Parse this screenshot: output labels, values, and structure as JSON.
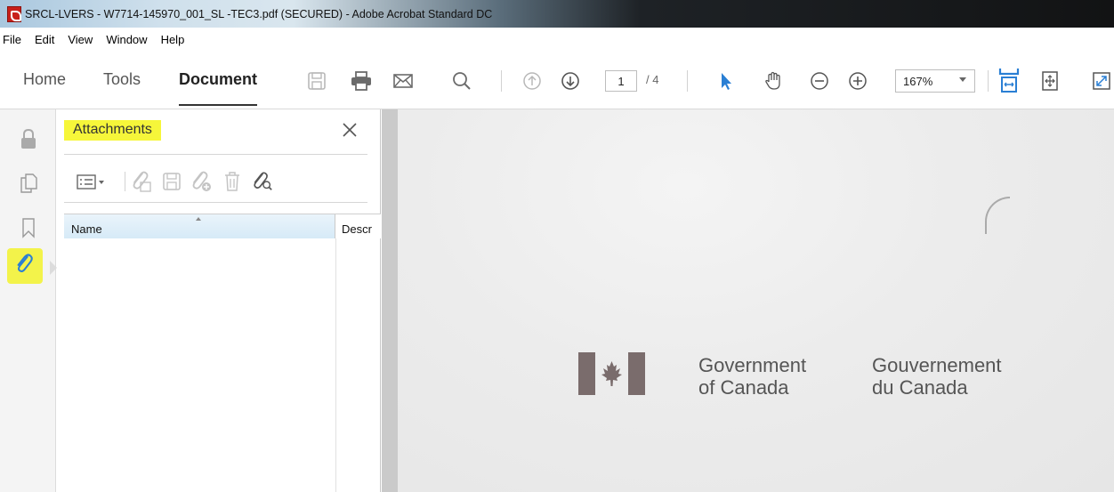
{
  "window": {
    "title": "SRCL-LVERS - W7714-145970_001_SL -TEC3.pdf (SECURED) - Adobe Acrobat Standard DC"
  },
  "menu": [
    "File",
    "Edit",
    "View",
    "Window",
    "Help"
  ],
  "toolbar": {
    "tabs": [
      {
        "label": "Home",
        "active": false
      },
      {
        "label": "Tools",
        "active": false
      },
      {
        "label": "Document",
        "active": true
      }
    ],
    "icons": [
      "save-icon",
      "print-icon",
      "email-icon",
      "search-icon",
      "previous-page-icon",
      "next-page-icon",
      "select-arrow-icon",
      "hand-tool-icon",
      "zoom-out-icon",
      "zoom-in-icon",
      "fit-width-icon",
      "fit-page-icon",
      "full-screen-icon"
    ],
    "page_current": "1",
    "page_total": "/ 4",
    "zoom": "167%"
  },
  "rail": {
    "icons": [
      "lock-icon",
      "pages-icon",
      "bookmark-icon",
      "attachment-icon"
    ],
    "highlight_color": "#f3f34a"
  },
  "panel": {
    "title": "Attachments",
    "highlight_color": "#f6f63a",
    "tools": [
      "options-dropdown-icon",
      "open-attachment-icon",
      "save-attachment-icon",
      "add-attachment-icon",
      "delete-attachment-icon",
      "search-attachment-icon"
    ],
    "columns": {
      "name": "Name",
      "description": "Descr"
    }
  },
  "document": {
    "gov_en_line1": "Government",
    "gov_en_line2": "of Canada",
    "gov_fr_line1": "Gouvernement",
    "gov_fr_line2": "du Canada"
  }
}
